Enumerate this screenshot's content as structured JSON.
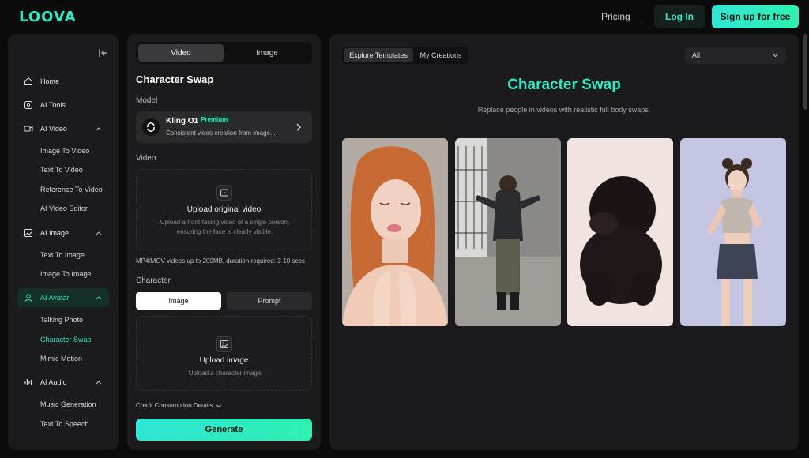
{
  "brand": {
    "logo": "LOOVA"
  },
  "topnav": {
    "pricing": "Pricing",
    "login": "Log In",
    "signup": "Sign up for free"
  },
  "sidebar": {
    "items": [
      {
        "label": "Home",
        "icon": "home-icon"
      },
      {
        "label": "AI Tools",
        "icon": "tools-icon"
      },
      {
        "label": "AI Video",
        "icon": "video-icon",
        "children": [
          "Image To Video",
          "Text To Video",
          "Reference To Video",
          "AI Video Editor"
        ]
      },
      {
        "label": "AI Image",
        "icon": "image-icon",
        "children": [
          "Text To Image",
          "Image To Image"
        ]
      },
      {
        "label": "AI Avatar",
        "icon": "avatar-icon",
        "active": true,
        "children": [
          "Talking Photo",
          "Character Swap",
          "Mimic Motion"
        ]
      },
      {
        "label": "AI Audio",
        "icon": "audio-icon",
        "children": [
          "Music Generation",
          "Text To Speech"
        ]
      }
    ],
    "active_sub": "Character Swap"
  },
  "panel": {
    "tabs": [
      "Video",
      "Image"
    ],
    "active_tab": "Video",
    "title": "Character Swap",
    "model_label": "Model",
    "model": {
      "name": "Kling O1",
      "badge": "Premium",
      "desc": "Consistent video creation from image..."
    },
    "video_label": "Video",
    "video_upload": {
      "title": "Upload original video",
      "desc": "Upload a front-facing video of a single person, ensuring the face is clearly visible."
    },
    "video_hint": "MP4/MOV videos up to 200MB, duration required: 3-10 secs",
    "character_label": "Character",
    "character_tabs": [
      "Image",
      "Prompt"
    ],
    "character_upload": {
      "title": "Upload image",
      "desc": "Upload a character image"
    },
    "credit": "Credit Consumption Details",
    "generate": "Generate"
  },
  "main": {
    "tabs": [
      "Explore Templates",
      "My Creations"
    ],
    "active_tab": "Explore Templates",
    "filter": "All",
    "title": "Character Swap",
    "subtitle": "Replace people in videos with realistic full body swaps."
  },
  "colors": {
    "accent": "#2ee8c4",
    "panel": "#1b1b1d",
    "background": "#0b0b0c"
  }
}
